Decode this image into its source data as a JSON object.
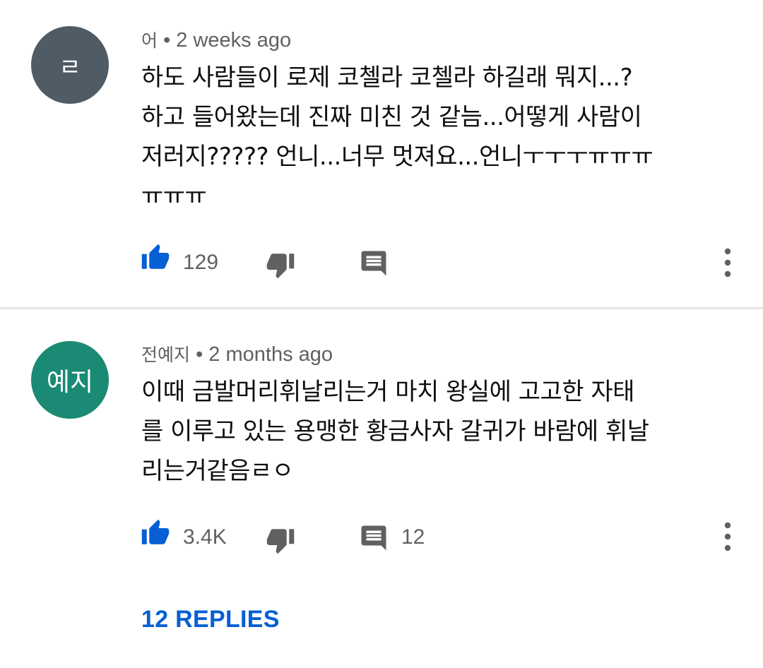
{
  "comments": [
    {
      "author": "어",
      "avatar_letter": "ㄹ",
      "avatar_color": "#4f5c66",
      "time": "2 weeks ago",
      "text": "하도 사람들이 로제 코첼라 코첼라 하길래 뭐지...?\n하고 들어왔는데 진짜 미친 것 같늠...어떻게 사람이\n저러지????? 언니...너무 멋져요...언니ㅜㅜㅜㅠㅠㅠ\nㅠㅠㅠ",
      "likes": "129",
      "reply_count": ""
    },
    {
      "author": "전예지",
      "avatar_letter": "예지",
      "avatar_color": "#1b8a74",
      "time": "2 months ago",
      "text": "이때 금발머리휘날리는거 마치 왕실에 고고한 자태\n를 이루고 있는 용맹한 황금사자 갈귀가 바람에 휘날\n리는거같음ㄹㅇ",
      "likes": "3.4K",
      "reply_count": "12"
    }
  ],
  "separator": "•",
  "replies_link": "12 REPLIES",
  "colors": {
    "link": "#065fd4",
    "like_icon": "#065fd4",
    "muted": "#606060"
  },
  "icons": [
    "thumbs-up-icon",
    "thumbs-down-icon",
    "comment-icon",
    "more-vert-icon"
  ]
}
